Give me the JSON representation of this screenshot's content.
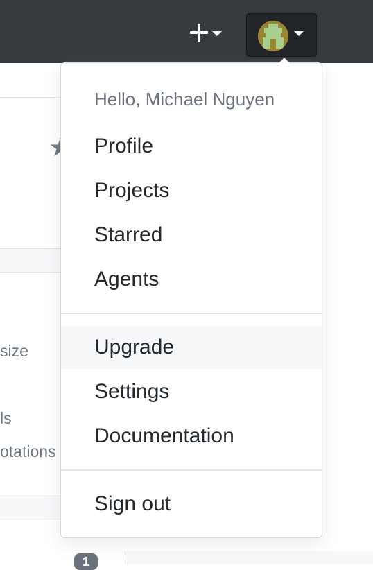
{
  "header": {
    "plus_icon": "plus-icon",
    "caret_icon": "caret-down-icon",
    "avatar_icon": "user-avatar"
  },
  "background": {
    "fragments": [
      "size",
      "ls",
      "otations"
    ],
    "counter": "1"
  },
  "dropdown": {
    "greeting": "Hello, Michael Nguyen",
    "sections": [
      {
        "items": [
          "Profile",
          "Projects",
          "Starred",
          "Agents"
        ]
      },
      {
        "items": [
          "Upgrade",
          "Settings",
          "Documentation"
        ]
      },
      {
        "items": [
          "Sign out"
        ]
      }
    ],
    "highlighted": "Upgrade"
  },
  "colors": {
    "topbar": "#373b3f",
    "text": "#24292e",
    "muted": "#6a737d",
    "hover": "#f6f8fa"
  }
}
